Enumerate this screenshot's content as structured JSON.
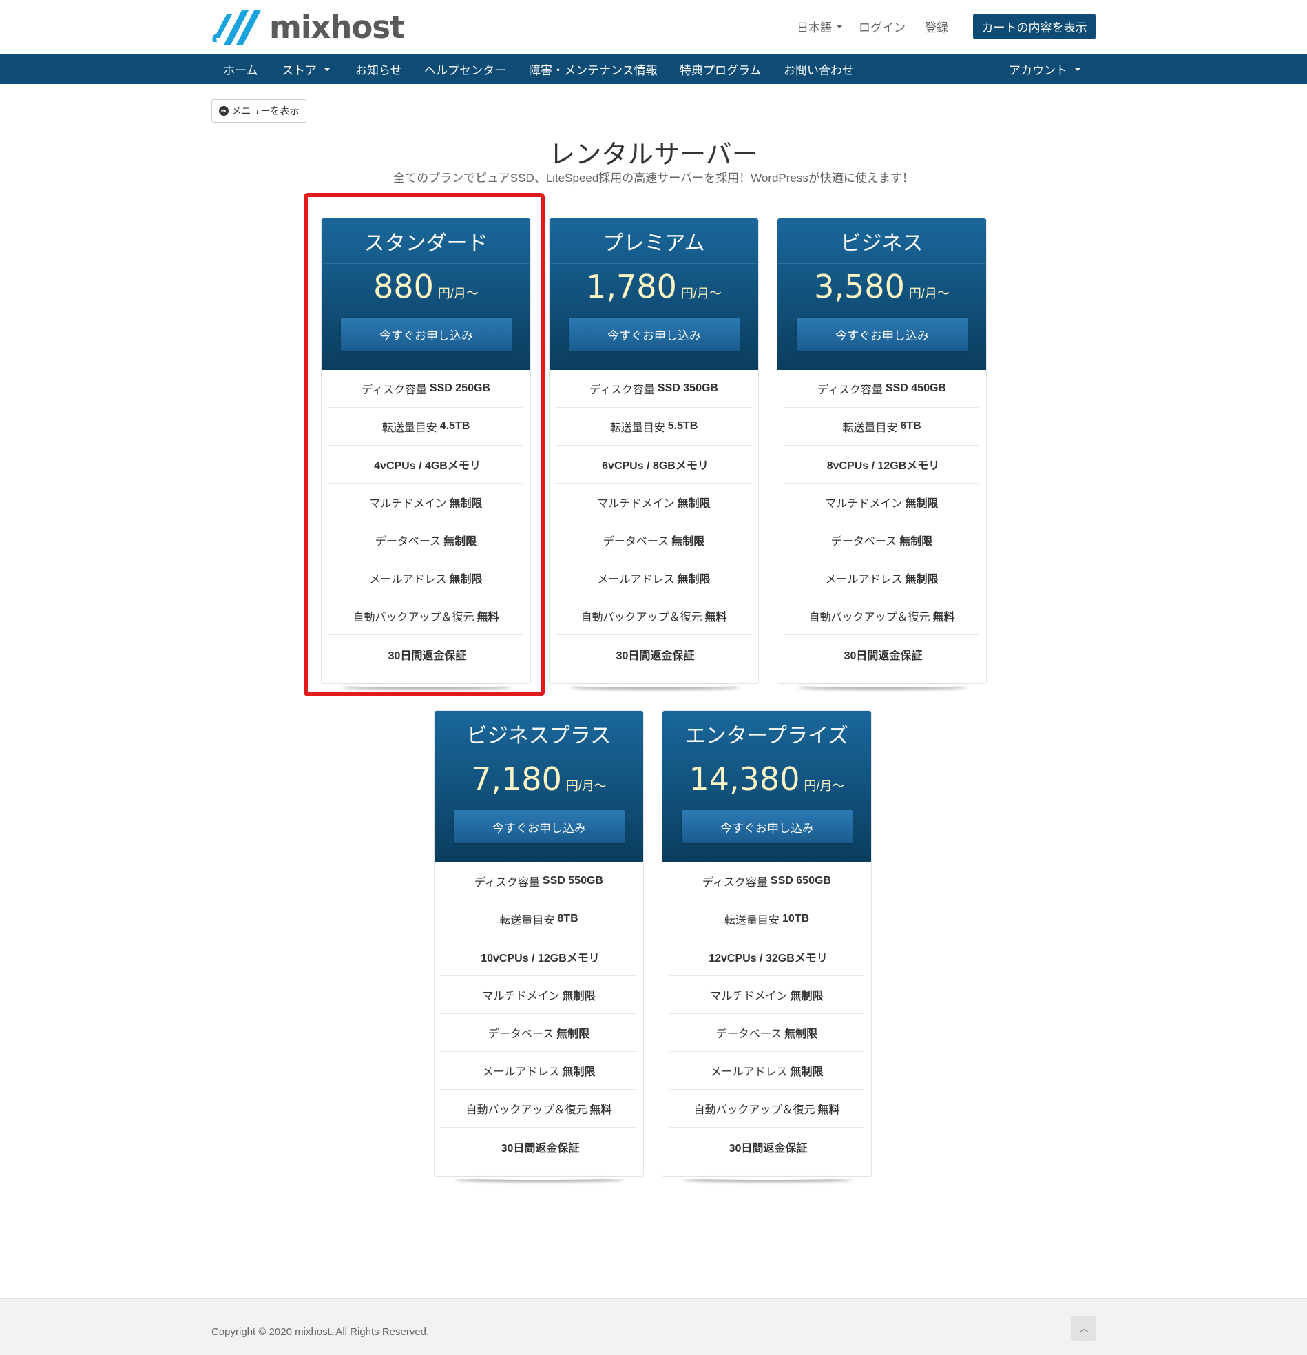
{
  "brand": {
    "name": "mixhost",
    "accent": "#0f4c75",
    "highlight": "#e01b1b",
    "price_color": "#fbf4c3"
  },
  "header": {
    "language": "日本語",
    "login": "ログイン",
    "register": "登録",
    "cart": "カートの内容を表示"
  },
  "nav": {
    "home": "ホーム",
    "store": "ストア",
    "news": "お知らせ",
    "help": "ヘルプセンター",
    "maintenance": "障害・メンテナンス情報",
    "benefits": "特典プログラム",
    "contact": "お問い合わせ",
    "account": "アカウント"
  },
  "menu_toggle": "メニューを表示",
  "page": {
    "title": "レンタルサーバー",
    "subtitle": "全てのプランでピュアSSD、LiteSpeed採用の高速サーバーを採用！WordPressが快適に使えます！"
  },
  "plans": [
    {
      "name": "スタンダード",
      "price": "880",
      "unit": "円/月〜",
      "apply": "今すぐお申し込み",
      "highlighted": true,
      "features": [
        {
          "label": "ディスク容量",
          "value": "SSD 250GB"
        },
        {
          "label": "転送量目安",
          "value": "4.5TB"
        },
        {
          "label": "",
          "value": "4vCPUs / 4GBメモリ"
        },
        {
          "label": "マルチドメイン",
          "value": "無制限"
        },
        {
          "label": "データベース",
          "value": "無制限"
        },
        {
          "label": "メールアドレス",
          "value": "無制限"
        },
        {
          "label": "自動バックアップ＆復元",
          "value": "無料"
        },
        {
          "label": "",
          "value": "30日間返金保証"
        }
      ]
    },
    {
      "name": "プレミアム",
      "price": "1,780",
      "unit": "円/月〜",
      "apply": "今すぐお申し込み",
      "features": [
        {
          "label": "ディスク容量",
          "value": "SSD 350GB"
        },
        {
          "label": "転送量目安",
          "value": "5.5TB"
        },
        {
          "label": "",
          "value": "6vCPUs / 8GBメモリ"
        },
        {
          "label": "マルチドメイン",
          "value": "無制限"
        },
        {
          "label": "データベース",
          "value": "無制限"
        },
        {
          "label": "メールアドレス",
          "value": "無制限"
        },
        {
          "label": "自動バックアップ＆復元",
          "value": "無料"
        },
        {
          "label": "",
          "value": "30日間返金保証"
        }
      ]
    },
    {
      "name": "ビジネス",
      "price": "3,580",
      "unit": "円/月〜",
      "apply": "今すぐお申し込み",
      "features": [
        {
          "label": "ディスク容量",
          "value": "SSD 450GB"
        },
        {
          "label": "転送量目安",
          "value": "6TB"
        },
        {
          "label": "",
          "value": "8vCPUs / 12GBメモリ"
        },
        {
          "label": "マルチドメイン",
          "value": "無制限"
        },
        {
          "label": "データベース",
          "value": "無制限"
        },
        {
          "label": "メールアドレス",
          "value": "無制限"
        },
        {
          "label": "自動バックアップ＆復元",
          "value": "無料"
        },
        {
          "label": "",
          "value": "30日間返金保証"
        }
      ]
    },
    {
      "name": "ビジネスプラス",
      "price": "7,180",
      "unit": "円/月〜",
      "apply": "今すぐお申し込み",
      "features": [
        {
          "label": "ディスク容量",
          "value": "SSD 550GB"
        },
        {
          "label": "転送量目安",
          "value": "8TB"
        },
        {
          "label": "",
          "value": "10vCPUs / 12GBメモリ"
        },
        {
          "label": "マルチドメイン",
          "value": "無制限"
        },
        {
          "label": "データベース",
          "value": "無制限"
        },
        {
          "label": "メールアドレス",
          "value": "無制限"
        },
        {
          "label": "自動バックアップ＆復元",
          "value": "無料"
        },
        {
          "label": "",
          "value": "30日間返金保証"
        }
      ]
    },
    {
      "name": "エンタープライズ",
      "price": "14,380",
      "unit": "円/月〜",
      "apply": "今すぐお申し込み",
      "features": [
        {
          "label": "ディスク容量",
          "value": "SSD 650GB"
        },
        {
          "label": "転送量目安",
          "value": "10TB"
        },
        {
          "label": "",
          "value": "12vCPUs / 32GBメモリ"
        },
        {
          "label": "マルチドメイン",
          "value": "無制限"
        },
        {
          "label": "データベース",
          "value": "無制限"
        },
        {
          "label": "メールアドレス",
          "value": "無制限"
        },
        {
          "label": "自動バックアップ＆復元",
          "value": "無料"
        },
        {
          "label": "",
          "value": "30日間返金保証"
        }
      ]
    }
  ],
  "footer": {
    "copyright": "Copyright © 2020 mixhost. All Rights Reserved."
  }
}
